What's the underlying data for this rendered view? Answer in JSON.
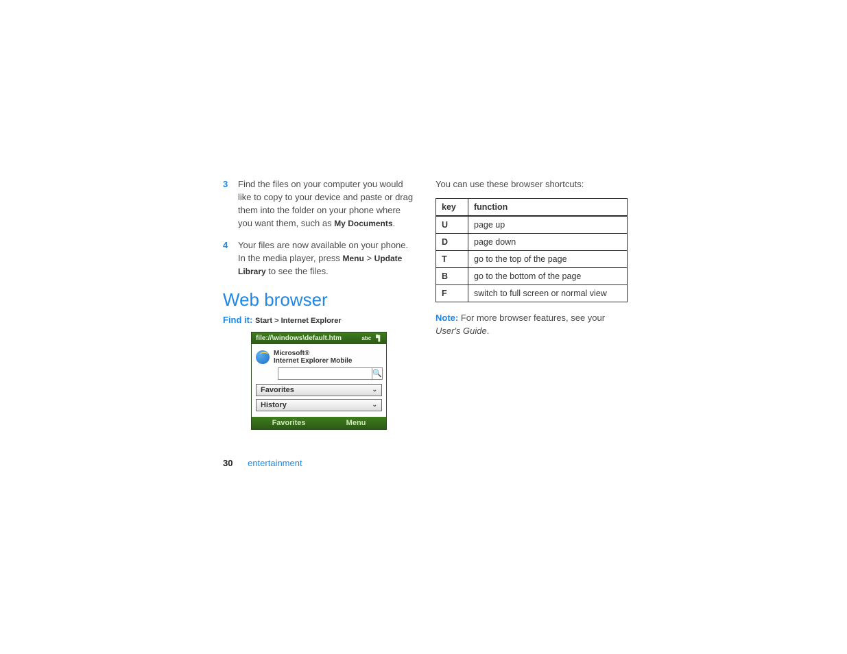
{
  "steps": [
    {
      "num": "3",
      "pre": "Find the files on your computer you would like to copy to your device and paste or drag them into the folder on your phone where you want them, such as ",
      "bold": "My Documents",
      "post": "."
    },
    {
      "num": "4",
      "pre": "Your files are now available on your phone. In the media player, press ",
      "bold": "Menu",
      "mid": " > ",
      "bold2": "Update Library",
      "post2": " to see the files."
    }
  ],
  "section_title": "Web browser",
  "findit": {
    "lead": "Find it:",
    "start": "Start",
    "sep": ">",
    "app": "Internet Explorer"
  },
  "phone": {
    "titlebar": "file://\\windows\\default.htm",
    "status_abc": "abc",
    "brand1": "Microsoft®",
    "brand2": "Internet Explorer Mobile",
    "row1": "Favorites",
    "row2": "History",
    "soft_left": "Favorites",
    "soft_right": "Menu"
  },
  "right_intro": "You can use these browser shortcuts:",
  "table": {
    "head_key": "key",
    "head_fn": "function",
    "rows": [
      {
        "k": "U",
        "f": "page up"
      },
      {
        "k": "D",
        "f": "page down"
      },
      {
        "k": "T",
        "f": "go to the top of the page"
      },
      {
        "k": "B",
        "f": "go to the bottom of the page"
      },
      {
        "k": "F",
        "f": "switch to full screen or normal view"
      }
    ]
  },
  "note": {
    "lead": "Note:",
    "text": " For more browser features, see your ",
    "ital": "User's Guide",
    "tail": "."
  },
  "footer": {
    "page": "30",
    "section": "entertainment"
  }
}
